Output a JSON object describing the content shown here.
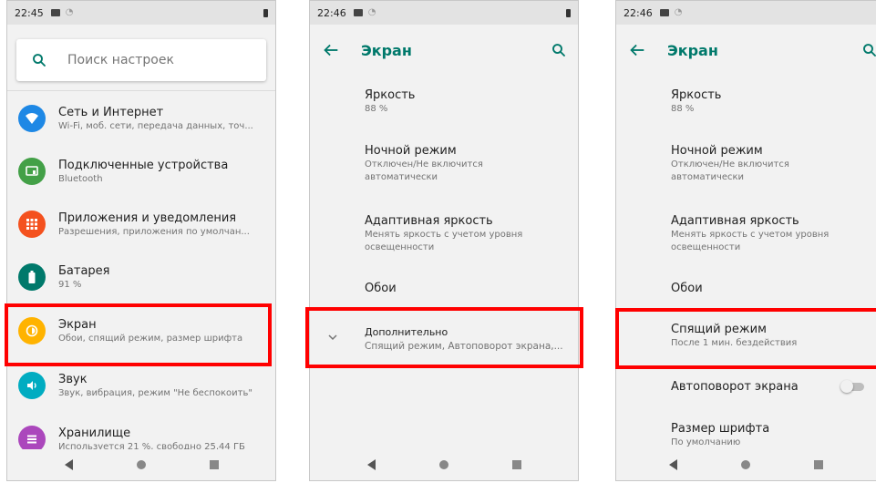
{
  "panel1": {
    "status_time": "22:45",
    "search_placeholder": "Поиск настроек",
    "items": [
      {
        "title": "Сеть и Интернет",
        "subtitle": "Wi-Fi, моб. сети, передача данных, точ...",
        "color": "#1e88e5",
        "icon": "wifi-icon"
      },
      {
        "title": "Подключенные устройства",
        "subtitle": "Bluetooth",
        "color": "#43a047",
        "icon": "devices-icon"
      },
      {
        "title": "Приложения и уведомления",
        "subtitle": "Разрешения, приложения по умолчан...",
        "color": "#f4511e",
        "icon": "apps-icon"
      },
      {
        "title": "Батарея",
        "subtitle": "91 %",
        "color": "#00796b",
        "icon": "battery-icon"
      },
      {
        "title": "Экран",
        "subtitle": "Обои, спящий режим, размер шрифта",
        "color": "#ffb300",
        "icon": "brightness-icon"
      },
      {
        "title": "Звук",
        "subtitle": "Звук, вибрация, режим \"Не беспокоить\"",
        "color": "#00acc1",
        "icon": "volume-icon"
      },
      {
        "title": "Хранилище",
        "subtitle": "Используется 21 %, свободно 25,44 ГБ",
        "color": "#ab47bc",
        "icon": "storage-icon"
      }
    ]
  },
  "panel2": {
    "status_time": "22:46",
    "title": "Экран",
    "items": [
      {
        "title": "Яркость",
        "subtitle": "88 %"
      },
      {
        "title": "Ночной режим",
        "subtitle": "Отключен/Не включится автоматически"
      },
      {
        "title": "Адаптивная яркость",
        "subtitle": "Менять яркость с учетом уровня освещенности"
      },
      {
        "title": "Обои",
        "subtitle": ""
      },
      {
        "title": "Дополнительно",
        "subtitle": "Спящий режим, Автоповорот экрана,..."
      }
    ]
  },
  "panel3": {
    "status_time": "22:46",
    "title": "Экран",
    "items": [
      {
        "title": "Яркость",
        "subtitle": "88 %"
      },
      {
        "title": "Ночной режим",
        "subtitle": "Отключен/Не включится автоматически"
      },
      {
        "title": "Адаптивная яркость",
        "subtitle": "Менять яркость с учетом уровня освещенности"
      },
      {
        "title": "Обои",
        "subtitle": ""
      },
      {
        "title": "Спящий режим",
        "subtitle": "После 1 мин. бездействия"
      },
      {
        "title": "Автоповорот экрана",
        "subtitle": ""
      },
      {
        "title": "Размер шрифта",
        "subtitle": "По умолчанию"
      }
    ]
  },
  "colors": {
    "accent": "#00796b",
    "highlight": "#ff0000"
  }
}
